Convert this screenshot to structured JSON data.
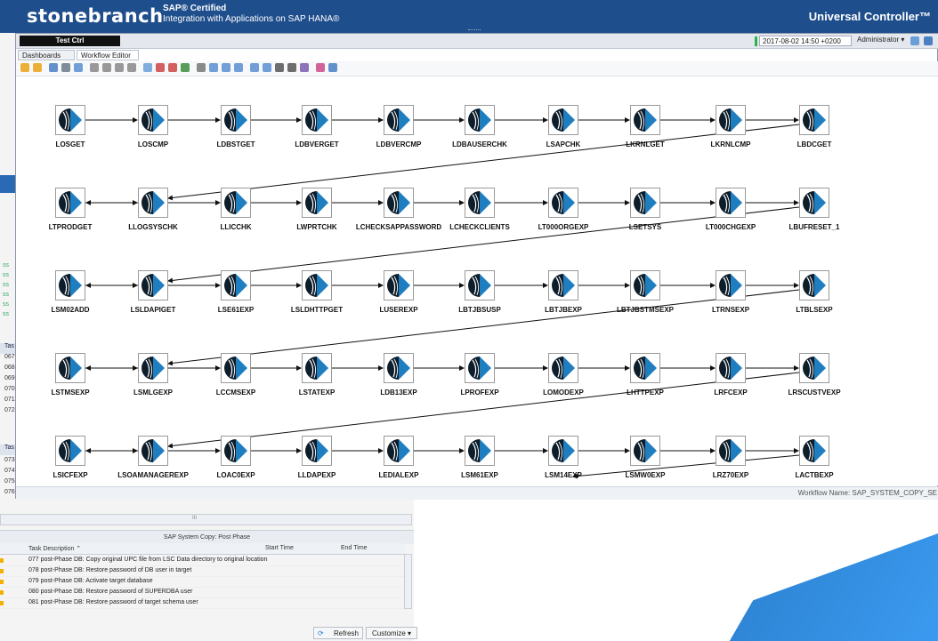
{
  "banner": {
    "brand": "stonebranch",
    "sap_cert_line1": "SAP® Certified",
    "sap_cert_line2": "Integration with Applications on SAP HANA®",
    "product": "Universal Controller™"
  },
  "header": {
    "controller_name": "Test Ctrl",
    "datetime": "2017-08-02 14:50 +0200",
    "user_menu": "Administrator ▾"
  },
  "tabs": [
    {
      "label": "Dashboards"
    },
    {
      "label": "Workflow Editor"
    }
  ],
  "workflow": {
    "rows": [
      [
        "LOSGET",
        "LOSCMP",
        "LDBSTGET",
        "LDBVERGET",
        "LDBVERCMP",
        "LDBAUSERCHK",
        "LSAPCHK",
        "LKRNLGET",
        "LKRNLCMP",
        "LBDCGET"
      ],
      [
        "LTPRODGET",
        "LLOGSYSCHK",
        "LLICCHK",
        "LWPRTCHK",
        "LCHECKSAPPASSWORD",
        "LCHECKCLIENTS",
        "LT000ORGEXP",
        "LSETSYS",
        "LT000CHGEXP",
        "LBUFRESET_1"
      ],
      [
        "LSM02ADD",
        "LSLDAPIGET",
        "LSE61EXP",
        "LSLDHTTPGET",
        "LUSEREXP",
        "LBTJBSUSP",
        "LBTJBEXP",
        "LBTJBSTMSEXP",
        "LTRNSEXP",
        "LTBLSEXP"
      ],
      [
        "LSTMSEXP",
        "LSMLGEXP",
        "LCCMSEXP",
        "LSTATEXP",
        "LDB13EXP",
        "LPROFEXP",
        "LOMODEXP",
        "LHTTPEXP",
        "LRFCEXP",
        "LRSCUSTVEXP"
      ],
      [
        "LSICFEXP",
        "LSOAMANAGEREXP",
        "LOAC0EXP",
        "LLDAPEXP",
        "LEDIALEXP",
        "LSM61EXP",
        "LSM14EXP",
        "LSMW0EXP",
        "LRZ70EXP",
        "LACTBEXP"
      ]
    ],
    "workflow_name_label": "Workflow Name: SAP_SYSTEM_COPY_SE"
  },
  "background": {
    "bg_rows": [
      "ss",
      "ss",
      "ss",
      "ss",
      "ss",
      "ss"
    ],
    "bg_nums_a": [
      "067",
      "068",
      "069",
      "070",
      "071",
      "072"
    ],
    "bg_nums_b": [
      "073",
      "074",
      "075",
      "076"
    ],
    "bg_hdr": "Tas",
    "bg_hdr2": "Tas"
  },
  "post_phase": {
    "title": "SAP System Copy: Post Phase",
    "columns": [
      "Task Description ⌃",
      "Start Time",
      "End Time"
    ],
    "rows": [
      "077 post-Phase DB: Copy original UPC file from LSC Data directory to original location",
      "078 post-Phase DB: Restore password of DB user in target",
      "079 post-Phase DB: Activate target database",
      "080 post-Phase DB: Restore password of SUPERDBA user",
      "081 post-Phase DB: Restore password of target schema user"
    ],
    "scroll_marker": "III",
    "refresh_label": "Refresh",
    "customize_label": "Customize ▾"
  },
  "colors": {
    "banner": "#1f4e8c",
    "accent": "#2f86d6",
    "status_ok": "#2db34a"
  }
}
